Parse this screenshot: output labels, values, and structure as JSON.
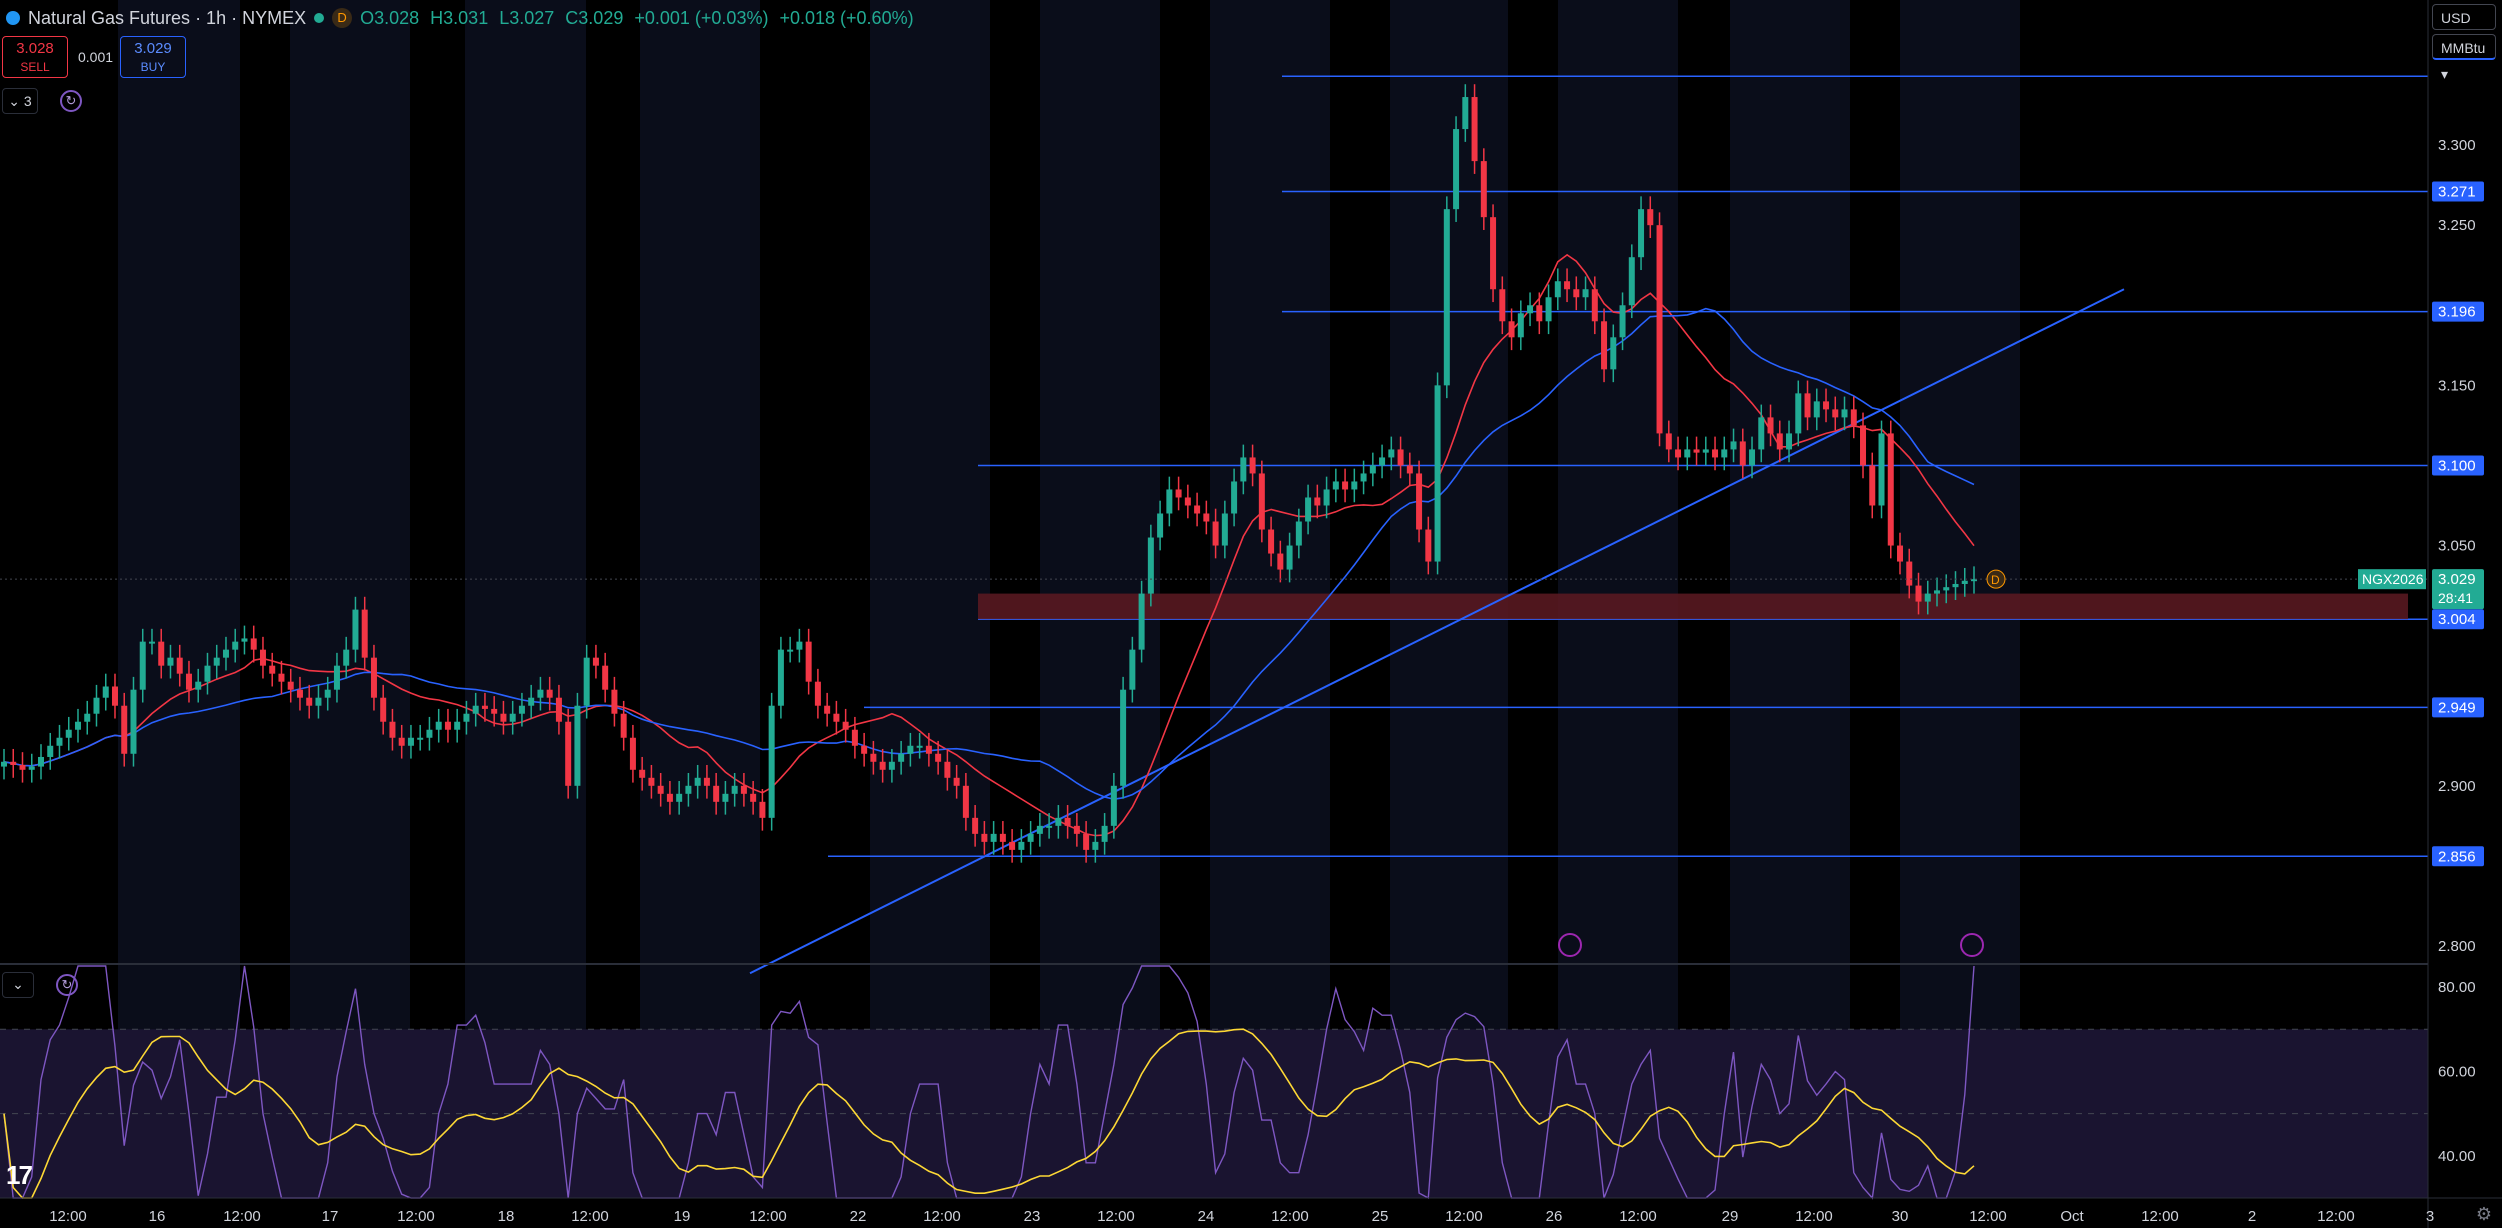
{
  "header": {
    "title": "Natural Gas Futures · 1h · NYMEX",
    "status_badge": "D",
    "open": "O3.028",
    "high": "H3.031",
    "low": "L3.027",
    "close": "C3.029",
    "change": "+0.001 (+0.03%)",
    "change2": "+0.018 (+0.60%)"
  },
  "trade": {
    "sell_price": "3.028",
    "sell_label": "SELL",
    "spread": "0.001",
    "buy_price": "3.029",
    "buy_label": "BUY"
  },
  "indicators_toggle": "3",
  "currency": "USD",
  "unit": "MMBtu",
  "colors": {
    "up": "#22ab94",
    "down": "#f23645",
    "line": "#2962ff",
    "ma_red": "#f23645",
    "ma_blue": "#2962ff",
    "rsi": "#7e57c2",
    "rsi_ma": "#fdd835",
    "zone": "#5d1a22"
  },
  "chart_data": {
    "type": "candlestick",
    "symbol": "NGX2026",
    "last_price": "3.029",
    "countdown": "28:41",
    "price_ticks": [
      "3.300",
      "3.250",
      "3.150",
      "3.050",
      "2.900",
      "2.800"
    ],
    "level_labels": [
      "3.271",
      "3.196",
      "3.100",
      "3.004",
      "2.949",
      "2.856"
    ],
    "x_labels": [
      "12:00",
      "16",
      "12:00",
      "17",
      "12:00",
      "18",
      "12:00",
      "19",
      "12:00",
      "22",
      "12:00",
      "23",
      "12:00",
      "24",
      "12:00",
      "25",
      "12:00",
      "26",
      "12:00",
      "29",
      "12:00",
      "30",
      "12:00",
      "Oct",
      "12:00",
      "2",
      "12:00",
      "3"
    ],
    "ylim": [
      2.79,
      3.35
    ],
    "horizontal_levels": [
      3.343,
      3.271,
      3.196,
      3.1,
      3.004,
      2.949,
      2.856
    ],
    "support_zone": [
      3.004,
      3.02
    ],
    "trendline": {
      "from_price": 2.783,
      "to_price": 3.21
    },
    "candles_close": [
      2.915,
      2.913,
      2.91,
      2.912,
      2.918,
      2.925,
      2.93,
      2.935,
      2.94,
      2.945,
      2.955,
      2.962,
      2.95,
      2.92,
      2.96,
      2.99,
      2.99,
      2.975,
      2.98,
      2.97,
      2.96,
      2.965,
      2.975,
      2.98,
      2.985,
      2.99,
      2.992,
      2.985,
      2.975,
      2.97,
      2.965,
      2.96,
      2.955,
      2.95,
      2.955,
      2.96,
      2.975,
      2.985,
      3.01,
      2.98,
      2.955,
      2.94,
      2.93,
      2.925,
      2.93,
      2.93,
      2.935,
      2.94,
      2.935,
      2.94,
      2.945,
      2.95,
      2.948,
      2.945,
      2.94,
      2.945,
      2.95,
      2.955,
      2.96,
      2.955,
      2.94,
      2.9,
      2.95,
      2.98,
      2.975,
      2.96,
      2.945,
      2.93,
      2.91,
      2.905,
      2.9,
      2.895,
      2.89,
      2.895,
      2.9,
      2.905,
      2.9,
      2.89,
      2.895,
      2.9,
      2.895,
      2.89,
      2.88,
      2.95,
      2.985,
      2.985,
      2.99,
      2.965,
      2.95,
      2.945,
      2.94,
      2.935,
      2.925,
      2.92,
      2.915,
      2.91,
      2.915,
      2.92,
      2.925,
      2.925,
      2.92,
      2.915,
      2.905,
      2.9,
      2.88,
      2.87,
      2.865,
      2.87,
      2.865,
      2.86,
      2.865,
      2.87,
      2.875,
      2.875,
      2.88,
      2.875,
      2.87,
      2.86,
      2.865,
      2.875,
      2.9,
      2.96,
      2.985,
      3.02,
      3.055,
      3.07,
      3.085,
      3.08,
      3.075,
      3.07,
      3.065,
      3.05,
      3.07,
      3.09,
      3.105,
      3.095,
      3.06,
      3.045,
      3.035,
      3.05,
      3.065,
      3.08,
      3.075,
      3.085,
      3.09,
      3.085,
      3.09,
      3.095,
      3.1,
      3.105,
      3.11,
      3.1,
      3.095,
      3.06,
      3.04,
      3.15,
      3.26,
      3.31,
      3.33,
      3.29,
      3.255,
      3.21,
      3.19,
      3.18,
      3.195,
      3.2,
      3.19,
      3.205,
      3.215,
      3.21,
      3.205,
      3.21,
      3.19,
      3.16,
      3.18,
      3.2,
      3.23,
      3.26,
      3.25,
      3.12,
      3.11,
      3.105,
      3.11,
      3.108,
      3.11,
      3.105,
      3.11,
      3.115,
      3.1,
      3.11,
      3.13,
      3.12,
      3.11,
      3.12,
      3.145,
      3.13,
      3.14,
      3.135,
      3.13,
      3.135,
      3.125,
      3.1,
      3.075,
      3.12,
      3.05,
      3.04,
      3.025,
      3.015,
      3.02,
      3.022,
      3.024,
      3.026,
      3.028,
      3.029
    ]
  },
  "rsi": {
    "ticks": [
      "80.00",
      "60.00",
      "40.00"
    ]
  },
  "chart_marks": {
    "flag_badge": "D"
  }
}
